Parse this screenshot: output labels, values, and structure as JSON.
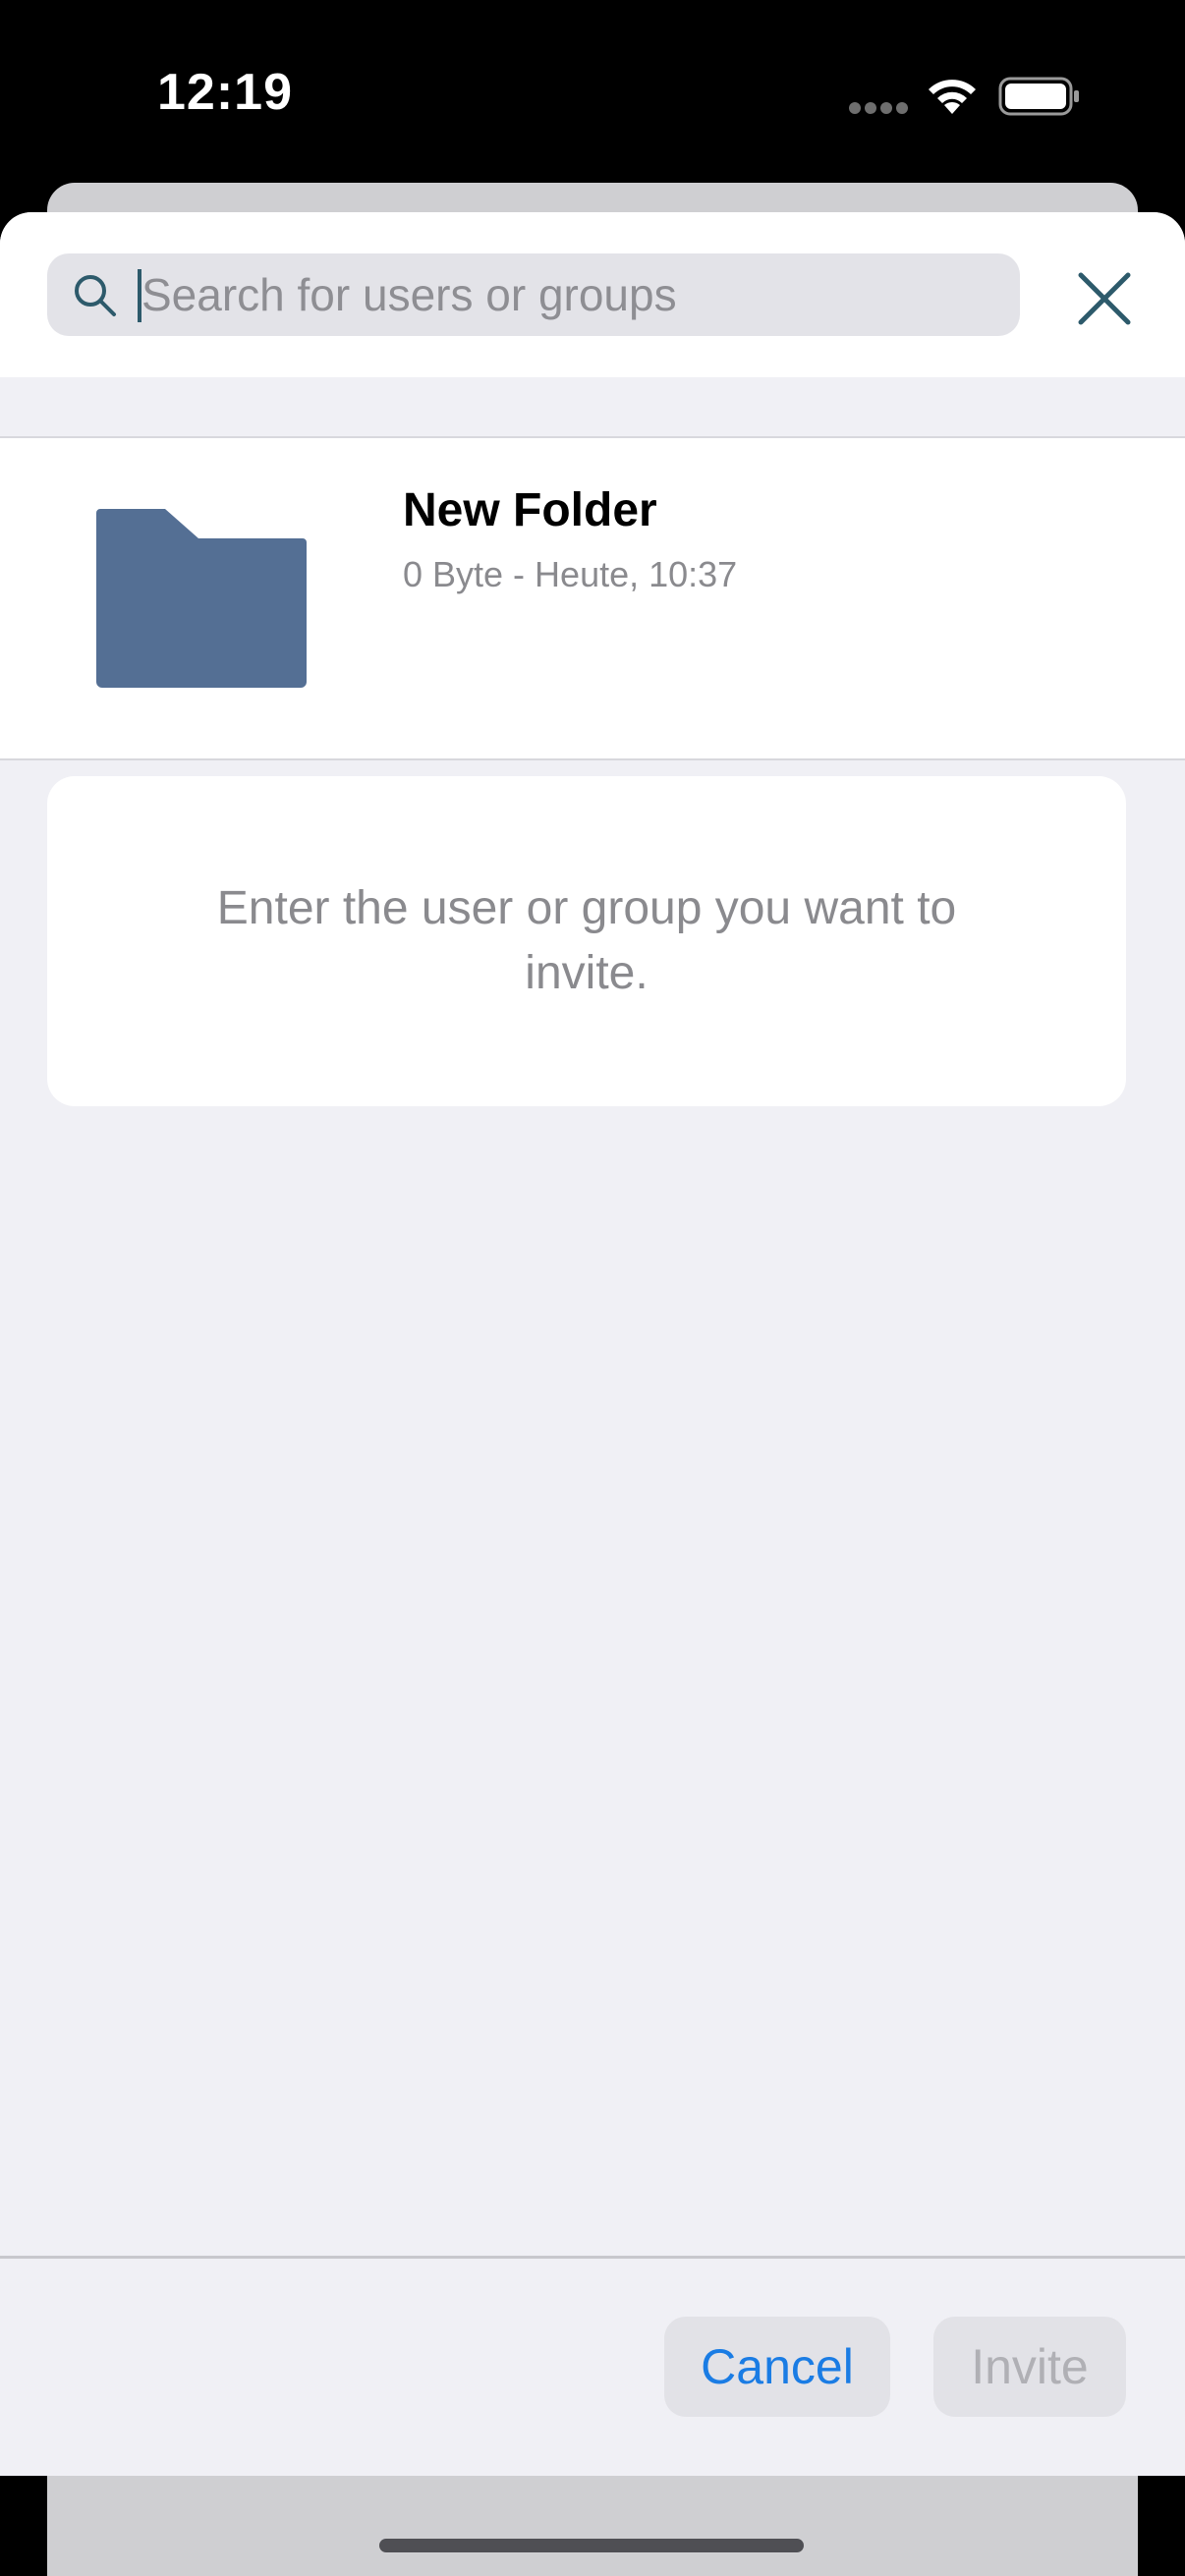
{
  "status_bar": {
    "time": "12:19"
  },
  "search": {
    "placeholder": "Search for users or groups",
    "value": ""
  },
  "icons": {
    "search": "search-icon",
    "close": "close-icon",
    "folder": "folder-icon",
    "wifi": "wifi-icon",
    "battery": "battery-icon"
  },
  "item": {
    "title": "New Folder",
    "meta": "0 Byte - Heute, 10:37"
  },
  "hint": {
    "text": "Enter the user or group you want to invite."
  },
  "footer": {
    "cancel_label": "Cancel",
    "invite_label": "Invite",
    "invite_enabled": false
  },
  "colors": {
    "accent": "#1a7ce4",
    "folder": "#546f94",
    "close_icon": "#2d5a6b",
    "sheet_background": "#f0f0f5"
  }
}
